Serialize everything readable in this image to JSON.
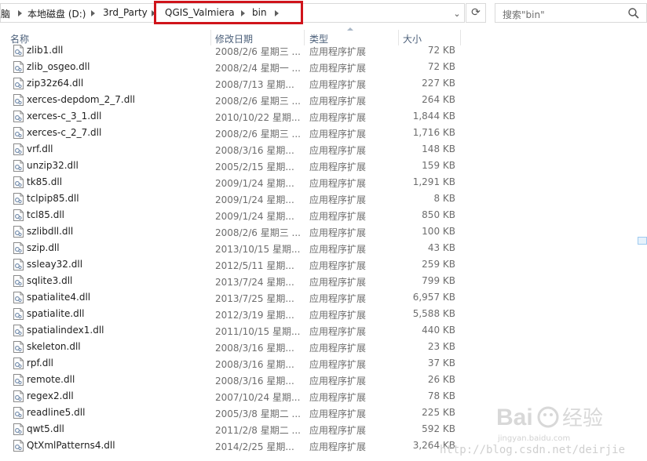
{
  "address_bar": {
    "crumbs": [
      "脑",
      "本地磁盘 (D:)",
      "3rd_Party",
      "QGIS_Valmiera",
      "bin"
    ]
  },
  "search": {
    "placeholder": "搜索\"bin\""
  },
  "columns": {
    "name": "名称",
    "date": "修改日期",
    "type": "类型",
    "size": "大小"
  },
  "files": [
    {
      "name": "zlib1.dll",
      "date": "2008/2/6 星期三 ...",
      "type": "应用程序扩展",
      "size": "72 KB"
    },
    {
      "name": "zlib_osgeo.dll",
      "date": "2008/2/4 星期一 ...",
      "type": "应用程序扩展",
      "size": "72 KB"
    },
    {
      "name": "zip32z64.dll",
      "date": "2008/7/13 星期...",
      "type": "应用程序扩展",
      "size": "227 KB"
    },
    {
      "name": "xerces-depdom_2_7.dll",
      "date": "2008/2/6 星期三 ...",
      "type": "应用程序扩展",
      "size": "264 KB"
    },
    {
      "name": "xerces-c_3_1.dll",
      "date": "2010/10/22 星期...",
      "type": "应用程序扩展",
      "size": "1,844 KB"
    },
    {
      "name": "xerces-c_2_7.dll",
      "date": "2008/2/6 星期三 ...",
      "type": "应用程序扩展",
      "size": "1,716 KB"
    },
    {
      "name": "vrf.dll",
      "date": "2008/3/16 星期...",
      "type": "应用程序扩展",
      "size": "148 KB"
    },
    {
      "name": "unzip32.dll",
      "date": "2005/2/15 星期...",
      "type": "应用程序扩展",
      "size": "159 KB"
    },
    {
      "name": "tk85.dll",
      "date": "2009/1/24 星期...",
      "type": "应用程序扩展",
      "size": "1,291 KB"
    },
    {
      "name": "tclpip85.dll",
      "date": "2009/1/24 星期...",
      "type": "应用程序扩展",
      "size": "8 KB"
    },
    {
      "name": "tcl85.dll",
      "date": "2009/1/24 星期...",
      "type": "应用程序扩展",
      "size": "850 KB"
    },
    {
      "name": "szlibdll.dll",
      "date": "2008/2/6 星期三 ...",
      "type": "应用程序扩展",
      "size": "100 KB"
    },
    {
      "name": "szip.dll",
      "date": "2013/10/15 星期...",
      "type": "应用程序扩展",
      "size": "43 KB"
    },
    {
      "name": "ssleay32.dll",
      "date": "2012/5/11 星期...",
      "type": "应用程序扩展",
      "size": "259 KB"
    },
    {
      "name": "sqlite3.dll",
      "date": "2013/7/24 星期...",
      "type": "应用程序扩展",
      "size": "799 KB"
    },
    {
      "name": "spatialite4.dll",
      "date": "2013/7/25 星期...",
      "type": "应用程序扩展",
      "size": "6,957 KB"
    },
    {
      "name": "spatialite.dll",
      "date": "2012/3/19 星期...",
      "type": "应用程序扩展",
      "size": "5,588 KB"
    },
    {
      "name": "spatialindex1.dll",
      "date": "2011/10/15 星期...",
      "type": "应用程序扩展",
      "size": "440 KB"
    },
    {
      "name": "skeleton.dll",
      "date": "2008/3/16 星期...",
      "type": "应用程序扩展",
      "size": "23 KB"
    },
    {
      "name": "rpf.dll",
      "date": "2008/3/16 星期...",
      "type": "应用程序扩展",
      "size": "37 KB"
    },
    {
      "name": "remote.dll",
      "date": "2008/3/16 星期...",
      "type": "应用程序扩展",
      "size": "26 KB"
    },
    {
      "name": "regex2.dll",
      "date": "2007/10/24 星期...",
      "type": "应用程序扩展",
      "size": "78 KB"
    },
    {
      "name": "readline5.dll",
      "date": "2005/3/8 星期二 ...",
      "type": "应用程序扩展",
      "size": "225 KB"
    },
    {
      "name": "qwt5.dll",
      "date": "2011/2/8 星期二 ...",
      "type": "应用程序扩展",
      "size": "592 KB"
    },
    {
      "name": "QtXmlPatterns4.dll",
      "date": "2014/2/25 星期...",
      "type": "应用程序扩展",
      "size": "3,264 KB"
    }
  ],
  "watermark": {
    "logo": "Bai经验",
    "url": "jingyan.baidu.com",
    "blog": "http://blog.csdn.net/deirjie"
  },
  "colors": {
    "highlight_box": "#d0141b",
    "header_text": "#4c607a",
    "secondary_text": "#6d6d6d"
  },
  "icons": {
    "file": "dll-file-icon",
    "search": "search-icon",
    "refresh": "refresh-icon"
  }
}
